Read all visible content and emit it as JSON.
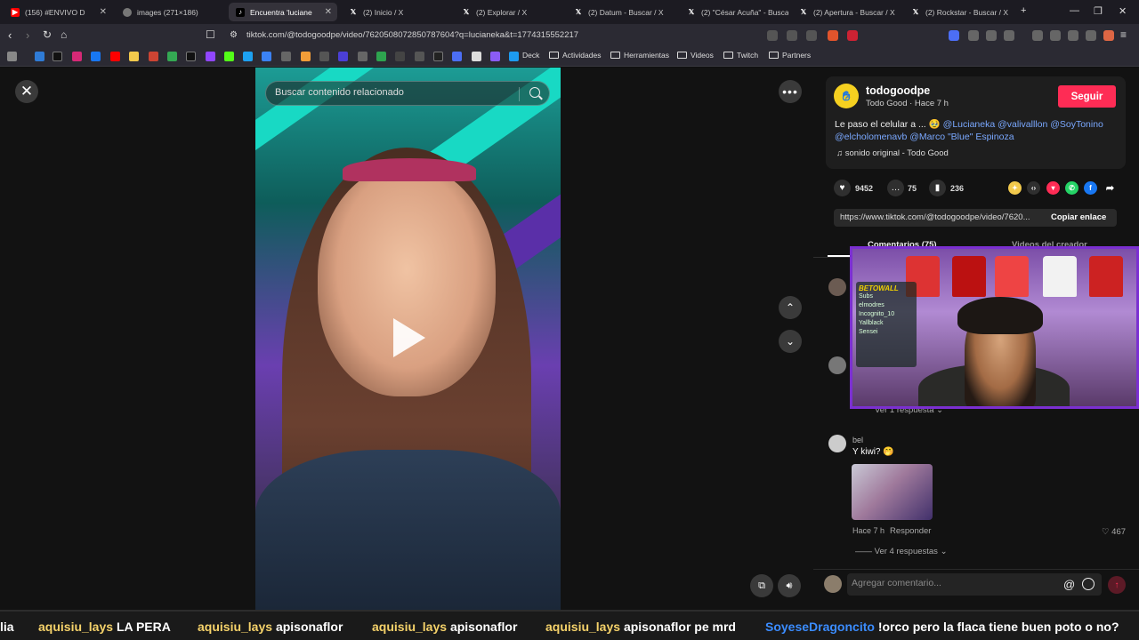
{
  "browser": {
    "tabs": [
      {
        "label": "(156) #ENVIVO D",
        "icon": "youtube-icon",
        "color": "#ff0000"
      },
      {
        "label": "images (271×186)",
        "icon": "globe-icon",
        "color": "#888888"
      },
      {
        "label": "Encuentra 'luciane",
        "icon": "tiktok-icon",
        "color": "#000000",
        "active": true
      },
      {
        "label": "(2) Inicio / X",
        "icon": "x-icon",
        "color": "#000000"
      },
      {
        "label": "(2) Explorar / X",
        "icon": "x-icon",
        "color": "#000000"
      },
      {
        "label": "(2) Datum - Buscar / X",
        "icon": "x-icon",
        "color": "#000000"
      },
      {
        "label": "(2) \"César Acuña\" - Buscar",
        "icon": "x-icon",
        "color": "#000000"
      },
      {
        "label": "(2) Apertura - Buscar / X",
        "icon": "x-icon",
        "color": "#000000"
      },
      {
        "label": "(2) Rockstar - Buscar / X",
        "icon": "x-icon",
        "color": "#000000"
      }
    ],
    "url": "tiktok.com/@todogoodpe/video/7620508072850787604?q=lucianeka&t=1774315552217",
    "bookmark_folders": [
      "Deck",
      "Actividades",
      "Herramientas",
      "Videos",
      "Twitch",
      "Partners"
    ]
  },
  "player": {
    "search_placeholder": "Buscar contenido relacionado"
  },
  "author": {
    "name": "todogoodpe",
    "meta": "Todo Good · Hace 7 h",
    "follow_label": "Seguir",
    "caption_prefix": "Le paso el celular a ... 🥹",
    "mentions": "@Lucianeka @valivalllon @SoyTonino @elcholomenavb @Marco \"Blue\" Espinoza",
    "sound": "sonido original - Todo Good"
  },
  "stats": {
    "likes": "9452",
    "comments": "75",
    "saves": "236"
  },
  "link": {
    "url": "https://www.tiktok.com/@todogoodpe/video/7620...",
    "copy_label": "Copiar enlace"
  },
  "tabs": {
    "comments": "Comentarios (75)",
    "creator_videos": "Videos del creador"
  },
  "comments": {
    "view_reply_1": "Ver 1 respuesta",
    "bel_name": "bel",
    "bel_text": "Y kiwi? 🤭",
    "bel_time": "Hace 7 h",
    "bel_reply": "Responder",
    "bel_likes": "467",
    "view_replies_4": "Ver 4 respuestas"
  },
  "comment_bar": {
    "placeholder": "Agregar comentario..."
  },
  "overlay": {
    "subs_title": "BETOWALL",
    "subs_lines": [
      "Subs",
      "elmodres",
      "Incognito_10",
      "Yallblack",
      "Sensei"
    ]
  },
  "ticker": [
    {
      "user": "",
      "msg": "lia"
    },
    {
      "user": "aquisiu_lays",
      "msg": "LA PERA"
    },
    {
      "user": "aquisiu_lays",
      "msg": "apisonaflor"
    },
    {
      "user": "aquisiu_lays",
      "msg": "apisonaflor"
    },
    {
      "user": "aquisiu_lays",
      "msg": "apisonaflor pe mrd"
    },
    {
      "user": "SoyeseDragoncito",
      "msg": "!orco pero la flaca tiene buen poto o no?"
    }
  ],
  "colors": {
    "accent": "#fe2c55",
    "mention": "#7aa8ff",
    "stream_border": "#7b2fd1"
  }
}
